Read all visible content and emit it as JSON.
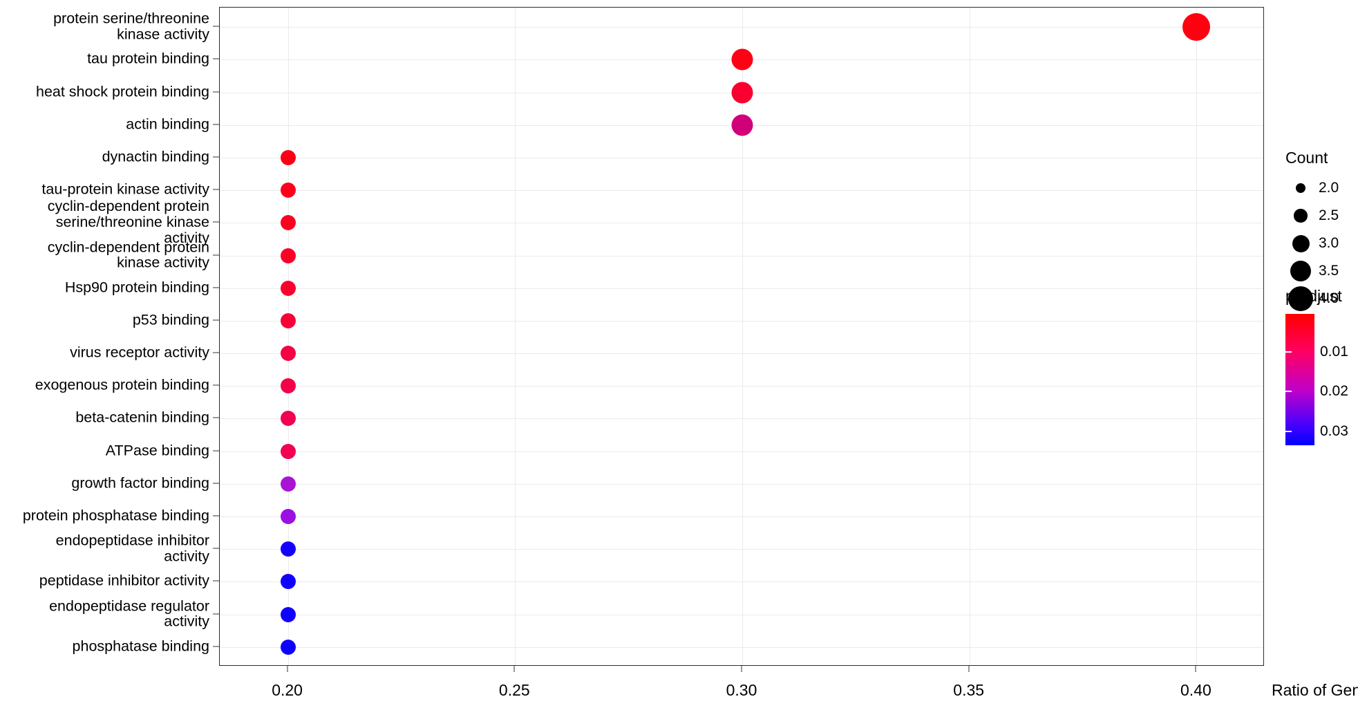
{
  "chart_data": {
    "type": "scatter",
    "title": "",
    "xlabel": "Ratio of Gene",
    "ylabel": "",
    "xlim": [
      0.185,
      0.415
    ],
    "xticks": [
      0.2,
      0.25,
      0.3,
      0.35,
      0.4
    ],
    "xticklabels": [
      "0.20",
      "0.25",
      "0.30",
      "0.35",
      "0.40"
    ],
    "grid": true,
    "legend_position": "right",
    "categories": [
      "protein serine/threonine\nkinase activity",
      "tau protein binding",
      "heat shock protein binding",
      "actin binding",
      "dynactin binding",
      "tau-protein kinase activity",
      "cyclin-dependent protein\nserine/threonine kinase\nactivity",
      "cyclin-dependent protein\nkinase activity",
      "Hsp90 protein binding",
      "p53 binding",
      "virus receptor activity",
      "exogenous protein binding",
      "beta-catenin binding",
      "ATPase binding",
      "growth factor binding",
      "protein phosphatase binding",
      "endopeptidase inhibitor\nactivity",
      "peptidase inhibitor activity",
      "endopeptidase regulator\nactivity",
      "phosphatase binding"
    ],
    "points": [
      {
        "term": "protein serine/threonine kinase activity",
        "x": 0.4,
        "count": 4,
        "padjust": 0.0008,
        "color": "#FF0010"
      },
      {
        "term": "tau protein binding",
        "x": 0.3,
        "count": 3,
        "padjust": 0.0012,
        "color": "#FF0014"
      },
      {
        "term": "heat shock protein binding",
        "x": 0.3,
        "count": 3,
        "padjust": 0.0025,
        "color": "#FA0030"
      },
      {
        "term": "actin binding",
        "x": 0.3,
        "count": 3,
        "padjust": 0.015,
        "color": "#D1007A"
      },
      {
        "term": "dynactin binding",
        "x": 0.2,
        "count": 2,
        "padjust": 0.001,
        "color": "#FE0016"
      },
      {
        "term": "tau-protein kinase activity",
        "x": 0.2,
        "count": 2,
        "padjust": 0.0014,
        "color": "#FD001B"
      },
      {
        "term": "cyclin-dependent protein serine/threonine kinase activity",
        "x": 0.2,
        "count": 2,
        "padjust": 0.0018,
        "color": "#FC0020"
      },
      {
        "term": "cyclin-dependent protein kinase activity",
        "x": 0.2,
        "count": 2,
        "padjust": 0.0022,
        "color": "#FB0026"
      },
      {
        "term": "Hsp90 protein binding",
        "x": 0.2,
        "count": 2,
        "padjust": 0.003,
        "color": "#FA002C"
      },
      {
        "term": "p53 binding",
        "x": 0.2,
        "count": 2,
        "padjust": 0.0048,
        "color": "#F70038"
      },
      {
        "term": "virus receptor activity",
        "x": 0.2,
        "count": 2,
        "padjust": 0.006,
        "color": "#F50042"
      },
      {
        "term": "exogenous protein binding",
        "x": 0.2,
        "count": 2,
        "padjust": 0.0068,
        "color": "#F3004A"
      },
      {
        "term": "beta-catenin binding",
        "x": 0.2,
        "count": 2,
        "padjust": 0.0074,
        "color": "#F20050"
      },
      {
        "term": "ATPase binding",
        "x": 0.2,
        "count": 2,
        "padjust": 0.008,
        "color": "#F10054"
      },
      {
        "term": "growth factor binding",
        "x": 0.2,
        "count": 2,
        "padjust": 0.0195,
        "color": "#A913D6"
      },
      {
        "term": "protein phosphatase binding",
        "x": 0.2,
        "count": 2,
        "padjust": 0.0215,
        "color": "#9B0FE2"
      },
      {
        "term": "endopeptidase inhibitor activity",
        "x": 0.2,
        "count": 2,
        "padjust": 0.03,
        "color": "#1500FF"
      },
      {
        "term": "peptidase inhibitor activity",
        "x": 0.2,
        "count": 2,
        "padjust": 0.0302,
        "color": "#1200FF"
      },
      {
        "term": "endopeptidase regulator activity",
        "x": 0.2,
        "count": 2,
        "padjust": 0.0305,
        "color": "#1000FF"
      },
      {
        "term": "phosphatase binding",
        "x": 0.2,
        "count": 2,
        "padjust": 0.0308,
        "color": "#0E00FF"
      }
    ],
    "size_legend": {
      "title": "Count",
      "values": [
        2.0,
        2.5,
        3.0,
        3.5,
        4.0
      ],
      "labels": [
        "2.0",
        "2.5",
        "3.0",
        "3.5",
        "4.0"
      ]
    },
    "color_legend": {
      "title": "p-adjust",
      "ticks": [
        0.01,
        0.02,
        0.03
      ],
      "labels": [
        "0.01",
        "0.02",
        "0.03"
      ],
      "low_color": "#FF0000",
      "high_color": "#0000FF",
      "range": [
        0.0005,
        0.0335
      ]
    }
  }
}
